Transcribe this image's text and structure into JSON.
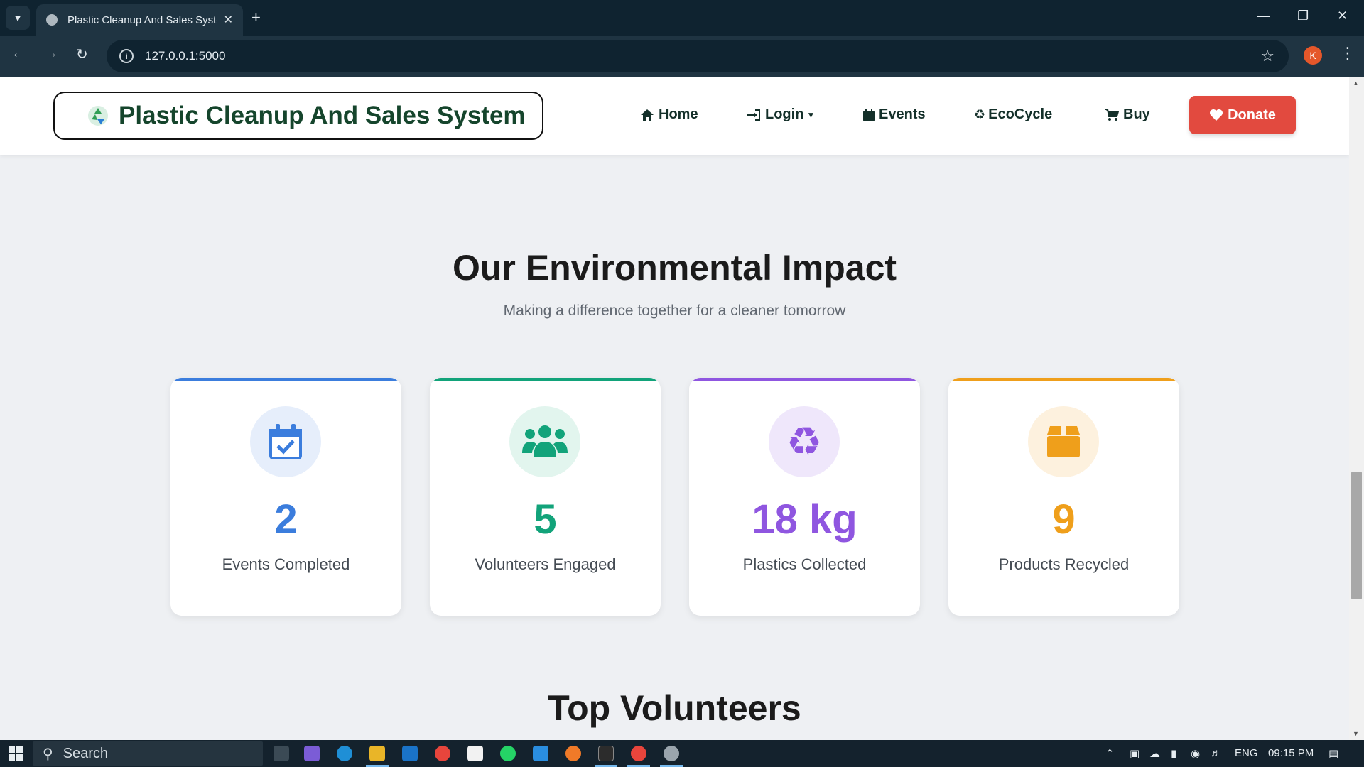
{
  "browser": {
    "tab_title": "Plastic Cleanup And Sales System",
    "url": "127.0.0.1:5000",
    "profile_initial": "K"
  },
  "site": {
    "brand": "Plastic Cleanup And Sales System",
    "nav": {
      "home": "Home",
      "login": "Login",
      "events": "Events",
      "ecocycle": "EcoCycle",
      "buy": "Buy",
      "donate": "Donate"
    }
  },
  "impact": {
    "title": "Our Environmental Impact",
    "subtitle": "Making a difference together for a cleaner tomorrow",
    "stats": [
      {
        "value": "2",
        "label": "Events Completed",
        "icon": "calendar-check-icon",
        "color": "#3b7ddd"
      },
      {
        "value": "5",
        "label": "Volunteers Engaged",
        "icon": "users-icon",
        "color": "#12a37a"
      },
      {
        "value": "18 kg",
        "label": "Plastics Collected",
        "icon": "recycle-icon",
        "color": "#8f56e0"
      },
      {
        "value": "9",
        "label": "Products Recycled",
        "icon": "box-icon",
        "color": "#ef9f1b"
      }
    ]
  },
  "volunteers": {
    "title": "Top Volunteers"
  },
  "taskbar": {
    "search_placeholder": "Search",
    "language": "ENG",
    "time": "09:15 PM"
  }
}
